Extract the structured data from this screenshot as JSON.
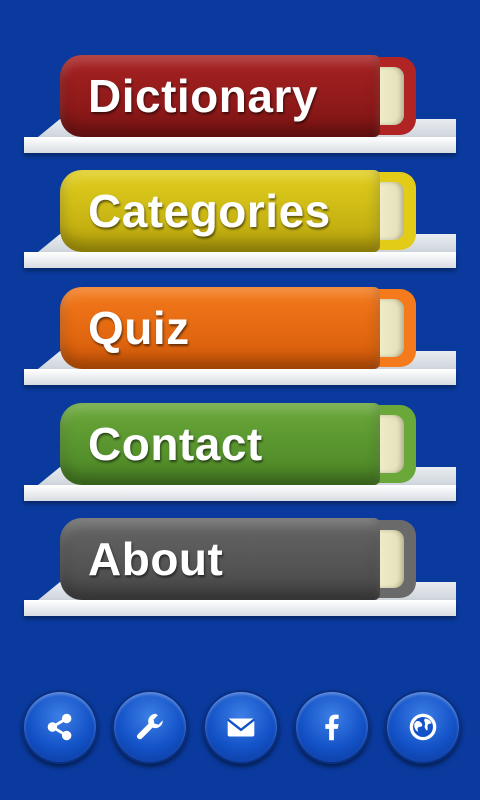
{
  "menu": {
    "books": [
      {
        "label": "Dictionary",
        "color": "#9a1c1c",
        "end_color": "#b02424"
      },
      {
        "label": "Categories",
        "color": "#d7c214",
        "end_color": "#e2cc18"
      },
      {
        "label": "Quiz",
        "color": "#f06a12",
        "end_color": "#f57a1c"
      },
      {
        "label": "Contact",
        "color": "#5e9a32",
        "end_color": "#6aa83a"
      },
      {
        "label": "About",
        "color": "#5a5a5a",
        "end_color": "#6a6a6a"
      }
    ]
  },
  "bottom_bar": {
    "buttons": [
      "share-icon",
      "wrench-icon",
      "mail-icon",
      "facebook-icon",
      "globe-icon"
    ]
  },
  "colors": {
    "background": "#0a3a9e"
  }
}
